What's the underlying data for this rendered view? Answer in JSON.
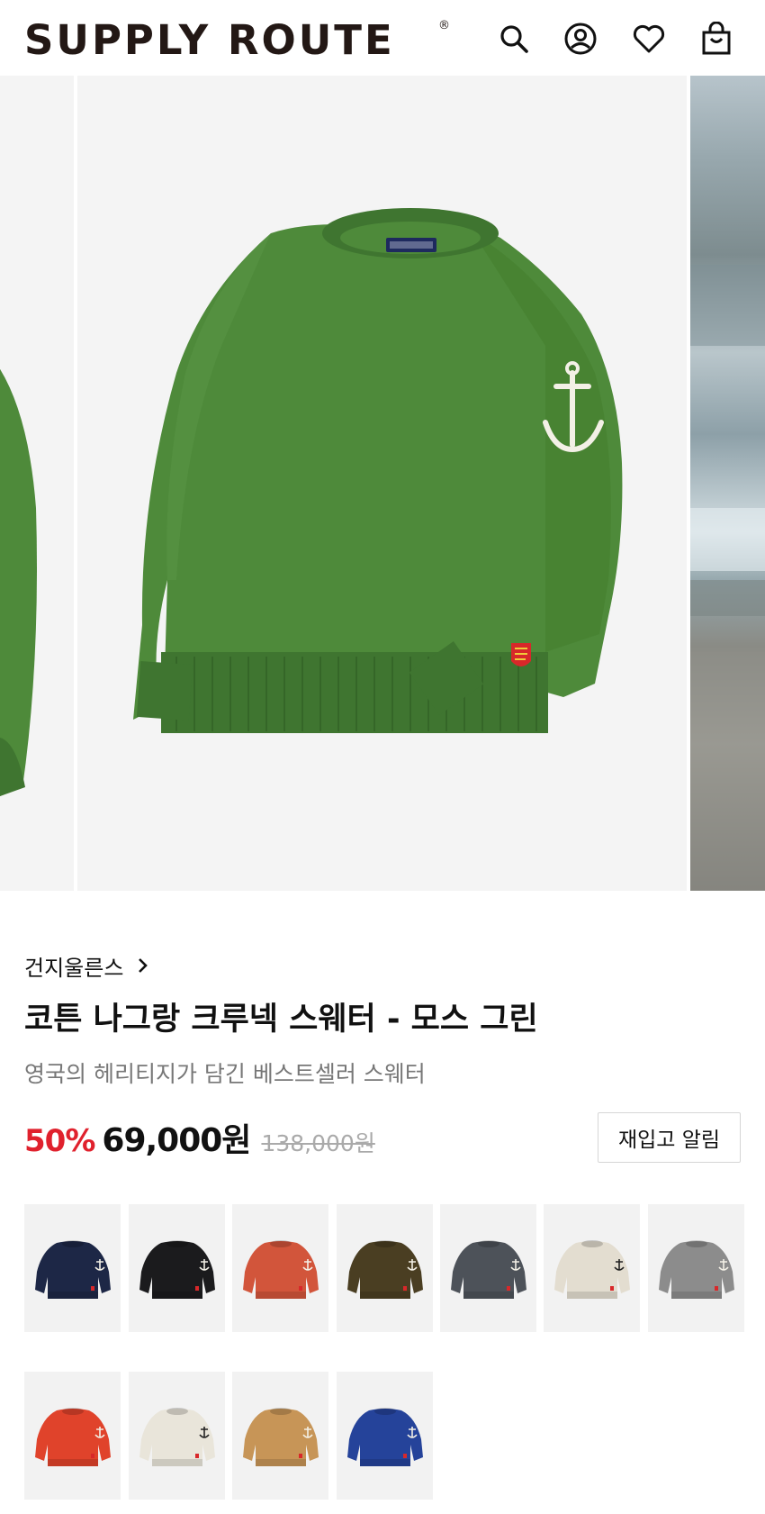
{
  "header": {
    "logo_text": "SUPPLY ROUTE",
    "logo_mark": "®",
    "icons": [
      "search-icon",
      "account-icon",
      "heart-icon",
      "bag-icon"
    ]
  },
  "gallery": {
    "current_color": "#4e8a3a",
    "prev_color": "#4e8a3a"
  },
  "product": {
    "brand": "건지울른스",
    "name": "코튼 나그랑 크루넥 스웨터 - 모스 그린",
    "subtitle": "영국의 헤리티지가 담긴 베스트셀러 스웨터",
    "discount": "50%",
    "price": "69,000원",
    "original_price": "138,000원",
    "restock_label": "재입고 알림"
  },
  "colors": {
    "accent_red": "#e0212d",
    "swatches": [
      "#1d2746",
      "#1b1b1d",
      "#d2553b",
      "#4a3e22",
      "#4d5259",
      "#e3ddd0",
      "#8c8c8c",
      "#e0432b",
      "#e9e5da",
      "#c79557",
      "#25439a"
    ]
  }
}
